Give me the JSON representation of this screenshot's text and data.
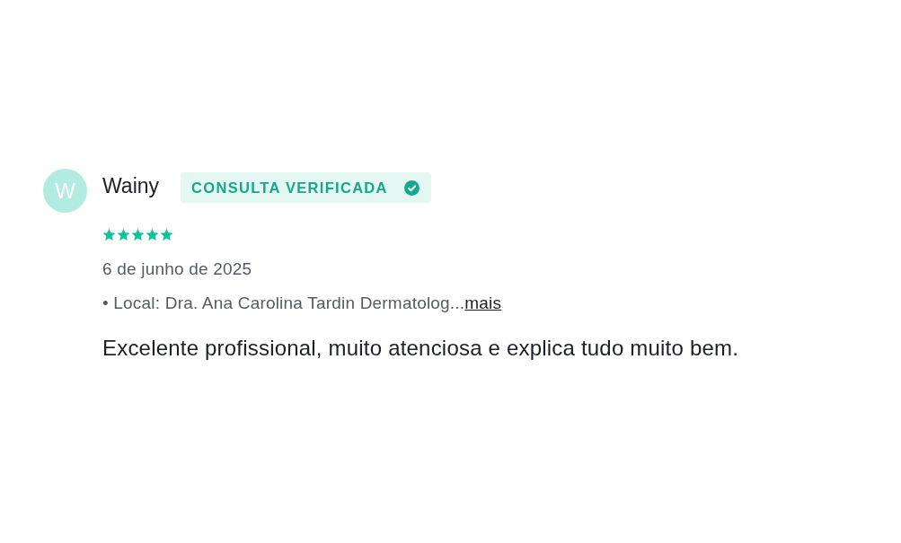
{
  "review": {
    "avatar_initial": "W",
    "author": "Wainy",
    "badge": {
      "label": "CONSULTA VERIFICADA",
      "verified": true
    },
    "stars": 5,
    "date": "6 de junho de 2025",
    "local": {
      "text": "• Local: Dra. Ana Carolina Tardin Dermatolog...",
      "link": "mais"
    },
    "text": "Excelente profissional, muito atenciosa e explica tudo muito bem."
  }
}
